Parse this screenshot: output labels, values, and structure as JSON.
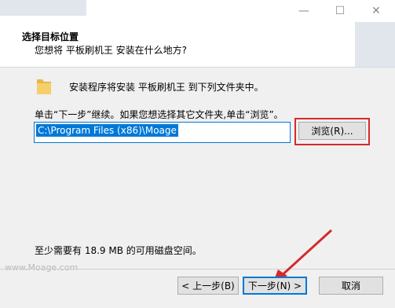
{
  "window": {
    "minimize_icon": "minimize-icon",
    "maximize_icon": "maximize-icon",
    "close_icon": "close-icon"
  },
  "header": {
    "title": "选择目标位置",
    "subtitle": "您想将 平板刷机王 安装在什么地方?"
  },
  "main": {
    "folder_icon": "folder-icon",
    "folder_text": "安装程序将安装 平板刷机王 到下列文件夹中。",
    "instruction": "单击“下一步”继续。如果您想选择其它文件夹,单击“浏览”。",
    "path_value": "C:\\Program Files (x86)\\Moage",
    "browse_label": "浏览(R)...",
    "space_text": "至少需要有 18.9 MB 的可用磁盘空间。"
  },
  "footer": {
    "watermark": "www.Moage.com",
    "back_label": "< 上一步(B)",
    "next_label": "下一步(N) >",
    "cancel_label": "取消"
  },
  "colors": {
    "accent": "#0078d7",
    "highlight_frame": "#d42a2a",
    "folder": "#e8b64c"
  }
}
